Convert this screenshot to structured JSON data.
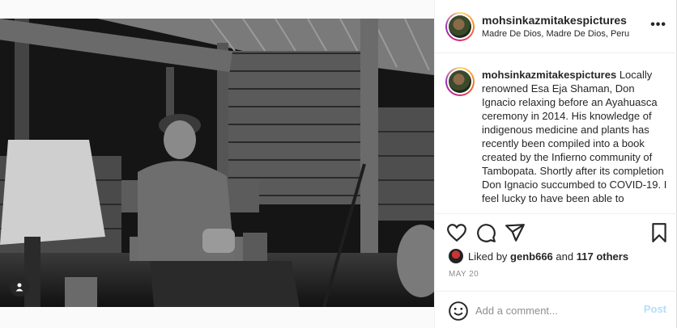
{
  "header": {
    "username": "mohsinkazmitakespictures",
    "location": "Madre De Dios, Madre De Dios, Peru",
    "more_label": "•••"
  },
  "caption": {
    "username": "mohsinkazmitakespictures",
    "text": "Locally renowned Esa Eja Shaman, Don Ignacio relaxing before an Ayahuasca ceremony in 2014. His knowledge of indigenous medicine and plants has recently been compiled into a book created by the Infierno community of Tambopata. Shortly after its completion Don Ignacio succumbed to COVID-19. I feel lucky to have been able to"
  },
  "icons": {
    "like": "heart-icon",
    "comment": "comment-icon",
    "share": "paper-plane-icon",
    "save": "bookmark-icon",
    "emoji": "emoji-icon",
    "tag": "user-tag-icon"
  },
  "likes": {
    "prefix": "Liked by",
    "user": "genb666",
    "conj": "and",
    "others": "117 others"
  },
  "date": "MAY 20",
  "comment_box": {
    "placeholder": "Add a comment...",
    "post_label": "Post"
  },
  "colors": {
    "accent_disabled": "#b2dffc",
    "text": "#262626",
    "muted": "#8e8e8e"
  }
}
